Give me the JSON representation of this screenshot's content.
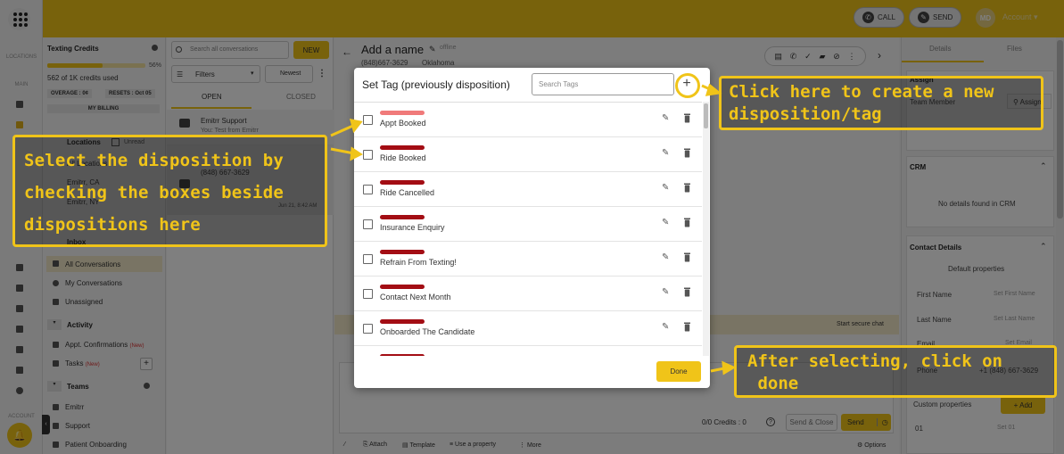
{
  "topbar": {
    "call_label": "CALL",
    "send_label": "SEND",
    "avatar_initials": "MD",
    "account_label": "Account"
  },
  "rail": {
    "locations_label": "LOCATIONS",
    "main_label": "MAIN",
    "account_label": "ACCOUNT"
  },
  "sidebar": {
    "title": "Texting Credits",
    "credits_percent": "56%",
    "credits_used": "562 of 1K credits used",
    "overage": "OVERAGE : 0¢",
    "resets": "RESETS : Oct 05",
    "my_billing": "MY BILLING",
    "locations_header": "Locations",
    "unread_label": "Unread",
    "loc_all": "All Locations",
    "loc_ca": "Emitrr, CA",
    "loc_ny": "Emitrr, NY",
    "inbox_header": "Inbox",
    "all_conversations": "All Conversations",
    "my_conversations": "My Conversations",
    "unassigned": "Unassigned",
    "activity_header": "Activity",
    "appt_confirmations": "Appt. Confirmations",
    "tasks": "Tasks",
    "new_badge": "(New)",
    "teams_header": "Teams",
    "team_emitrr": "Emitrr",
    "team_support": "Support",
    "team_patient": "Patient Onboarding"
  },
  "conversations": {
    "search_placeholder": "Search all conversations",
    "new_label": "NEW",
    "filters_label": "Filters",
    "newest_label": "Newest",
    "tab_open": "OPEN",
    "tab_closed": "CLOSED",
    "item1_name": "Emitrr Support",
    "item1_preview": "You: Test from Emitrr",
    "item2_phone": "(848) 667-3629",
    "item2_date": "Jun 21, 8:42 AM"
  },
  "main": {
    "contact_name": "Add a name",
    "status": "offline",
    "phone": "(848)667-3629",
    "place": "Oklahoma",
    "secure_chat": "Start secure chat",
    "credits_text": "0/0  Credits :  0",
    "send_close": "Send & Close",
    "send": "Send",
    "toolbar": {
      "attach": "Attach",
      "template": "Template",
      "use_property": "Use a property",
      "more": "More",
      "options": "Options"
    }
  },
  "right_panel": {
    "tab_details": "Details",
    "tab_files": "Files",
    "assign_header": "Assign",
    "team_member": "Team Member",
    "assign_btn": "Assign",
    "crm_header": "CRM",
    "crm_empty": "No details found in CRM",
    "contact_details_header": "Contact Details",
    "default_properties": "Default properties",
    "first_name": "First Name",
    "first_name_placeholder": "Set First Name",
    "last_name": "Last Name",
    "last_name_placeholder": "Set Last Name",
    "email": "Email",
    "email_placeholder": "Set Email",
    "phone_label": "Phone",
    "phone_value": "+1 (848) 667-3629",
    "custom_properties": "Custom properties",
    "add_label": "+ Add",
    "custom_row_name": "01",
    "custom_row_value": "Set 01"
  },
  "modal": {
    "title": "Set Tag (previously disposition)",
    "search_placeholder": "Search Tags",
    "add_icon": "+",
    "done_label": "Done",
    "tags": [
      {
        "name": "Appt Booked",
        "color": "#f07a7a"
      },
      {
        "name": "Ride Booked",
        "color": "#a30d14"
      },
      {
        "name": "Ride Cancelled",
        "color": "#a30d14"
      },
      {
        "name": "Insurance Enquiry",
        "color": "#a30d14"
      },
      {
        "name": "Refrain From Texting!",
        "color": "#a30d14"
      },
      {
        "name": "Contact Next Month",
        "color": "#a30d14"
      },
      {
        "name": "Onboarded The Candidate",
        "color": "#a30d14"
      }
    ]
  },
  "annotations": {
    "select_text": "Select the disposition by\nchecking the boxes beside\ndispositions here",
    "create_text": "Click here to create a new\ndisposition/tag",
    "done_text": "After selecting, click on\n done"
  },
  "colors": {
    "brand_yellow": "#f0c419",
    "tag_dark_red": "#a30d14",
    "tag_light_red": "#f07a7a"
  }
}
